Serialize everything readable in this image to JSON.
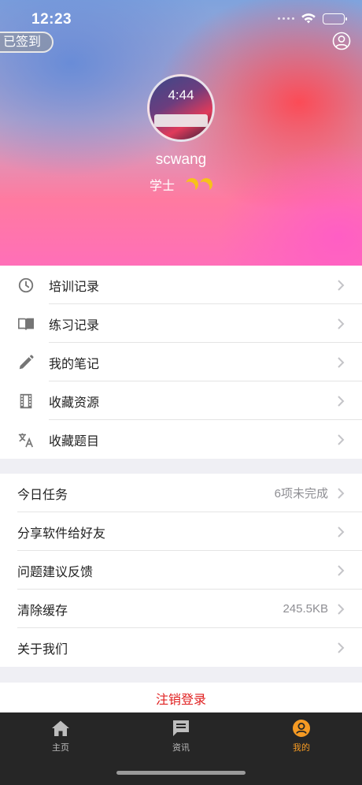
{
  "status": {
    "time": "12:23"
  },
  "header": {
    "checkin_label": "已签到",
    "profile_icon": "user-circle-icon",
    "username": "scwang",
    "rank": "学士",
    "avatar": {
      "time": "4:44"
    }
  },
  "menu1": [
    {
      "icon": "clock-icon",
      "label": "培训记录"
    },
    {
      "icon": "book-icon",
      "label": "练习记录"
    },
    {
      "icon": "pencil-icon",
      "label": "我的笔记"
    },
    {
      "icon": "film-icon",
      "label": "收藏资源"
    },
    {
      "icon": "translate-icon",
      "label": "收藏题目"
    }
  ],
  "menu2": [
    {
      "label": "今日任务",
      "value": "6项未完成"
    },
    {
      "label": "分享软件给好友",
      "value": ""
    },
    {
      "label": "问题建议反馈",
      "value": ""
    },
    {
      "label": "清除缓存",
      "value": "245.5KB"
    },
    {
      "label": "关于我们",
      "value": ""
    }
  ],
  "logout_label": "注销登录",
  "tabs": [
    {
      "icon": "home-icon",
      "label": "主页",
      "active": false
    },
    {
      "icon": "news-icon",
      "label": "资讯",
      "active": false
    },
    {
      "icon": "me-icon",
      "label": "我的",
      "active": true
    }
  ],
  "colors": {
    "accent": "#f59a23",
    "danger": "#e02020",
    "tabbar": "#262626"
  }
}
